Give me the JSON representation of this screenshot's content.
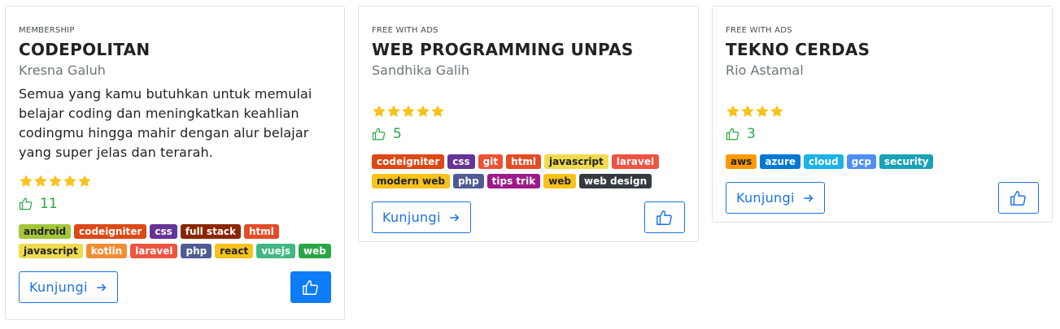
{
  "colors": {
    "accent": "#1a73e8",
    "like_green": "#28a745",
    "star": "#f7c21a"
  },
  "cards": [
    {
      "type": "MEMBERSHIP",
      "title": "CODEPOLITAN",
      "author": "Kresna Galuh",
      "description": "Semua yang kamu butuhkan untuk memulai belajar coding dan meningkatkan keahlian codingmu hingga mahir dengan alur belajar yang super jelas dan terarah.",
      "rating": 5,
      "likes": "11",
      "visit_label": "Kunjungi",
      "liked": true,
      "tags": [
        {
          "label": "android",
          "color": "#a4c639",
          "text": "dark"
        },
        {
          "label": "codeigniter",
          "color": "#dd4814",
          "text": "light"
        },
        {
          "label": "css",
          "color": "#663399",
          "text": "light"
        },
        {
          "label": "full stack",
          "color": "#8b2500",
          "text": "light"
        },
        {
          "label": "html",
          "color": "#e34c26",
          "text": "light"
        },
        {
          "label": "javascript",
          "color": "#f0db4f",
          "text": "dark"
        },
        {
          "label": "kotlin",
          "color": "#f18e33",
          "text": "light"
        },
        {
          "label": "laravel",
          "color": "#f05340",
          "text": "light"
        },
        {
          "label": "php",
          "color": "#4f5b93",
          "text": "light"
        },
        {
          "label": "react",
          "color": "#f7c21a",
          "text": "dark"
        },
        {
          "label": "vuejs",
          "color": "#41b883",
          "text": "light"
        },
        {
          "label": "web",
          "color": "#28a745",
          "text": "light"
        }
      ]
    },
    {
      "type": "FREE WITH ADS",
      "title": "WEB PROGRAMMING UNPAS",
      "author": "Sandhika Galih",
      "description": "",
      "rating": 5,
      "likes": "5",
      "visit_label": "Kunjungi",
      "liked": false,
      "tags": [
        {
          "label": "codeigniter",
          "color": "#dd4814",
          "text": "light"
        },
        {
          "label": "css",
          "color": "#663399",
          "text": "light"
        },
        {
          "label": "git",
          "color": "#f05033",
          "text": "light"
        },
        {
          "label": "html",
          "color": "#e34c26",
          "text": "light"
        },
        {
          "label": "javascript",
          "color": "#f0db4f",
          "text": "dark"
        },
        {
          "label": "laravel",
          "color": "#f05340",
          "text": "light"
        },
        {
          "label": "modern web",
          "color": "#f7c21a",
          "text": "dark"
        },
        {
          "label": "php",
          "color": "#4f5b93",
          "text": "light"
        },
        {
          "label": "tips trik",
          "color": "#9c1a8a",
          "text": "light"
        },
        {
          "label": "web",
          "color": "#f7c21a",
          "text": "dark"
        },
        {
          "label": "web design",
          "color": "#343a40",
          "text": "light"
        }
      ]
    },
    {
      "type": "FREE WITH ADS",
      "title": "TEKNO CERDAS",
      "author": "Rio Astamal",
      "description": "",
      "rating": 4,
      "likes": "3",
      "visit_label": "Kunjungi",
      "liked": false,
      "tags": [
        {
          "label": "aws",
          "color": "#ff9900",
          "text": "dark"
        },
        {
          "label": "azure",
          "color": "#0078d4",
          "text": "light"
        },
        {
          "label": "cloud",
          "color": "#1ab2e8",
          "text": "light"
        },
        {
          "label": "gcp",
          "color": "#4f8ef7",
          "text": "light"
        },
        {
          "label": "security",
          "color": "#17a2b8",
          "text": "light"
        }
      ]
    }
  ]
}
